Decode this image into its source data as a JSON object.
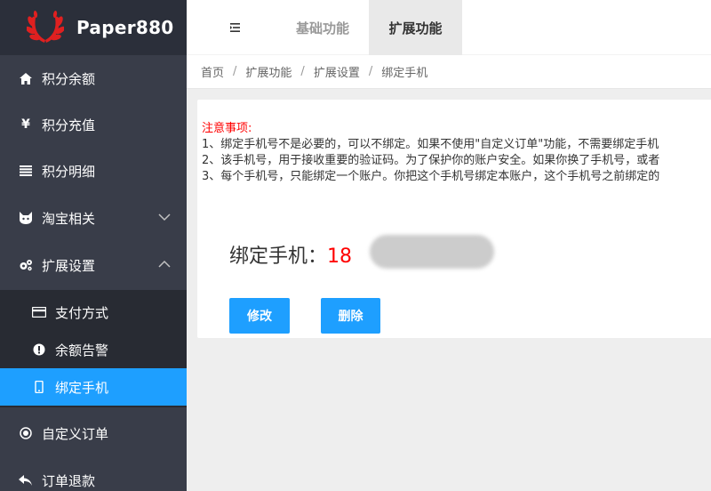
{
  "brand": {
    "name": "Paper880",
    "logo_icon": "laurel-logo-icon",
    "logo_color": "#e02020"
  },
  "sidebar": {
    "items": [
      {
        "label": "积分余额",
        "icon": "home-icon"
      },
      {
        "label": "积分充值",
        "icon": "yen-icon"
      },
      {
        "label": "积分明细",
        "icon": "list-icon"
      },
      {
        "label": "淘宝相关",
        "icon": "cat-icon"
      },
      {
        "label": "扩展设置",
        "icon": "gears-icon"
      },
      {
        "label": "自定义订单",
        "icon": "target-icon"
      },
      {
        "label": "订单退款",
        "icon": "reply-icon"
      }
    ],
    "subitems": [
      {
        "label": "支付方式",
        "icon": "card-icon"
      },
      {
        "label": "余额告警",
        "icon": "alert-icon"
      },
      {
        "label": "绑定手机",
        "icon": "mobile-icon"
      }
    ],
    "active_color": "#1e9fff"
  },
  "header": {
    "tabs": [
      {
        "label": "基础功能"
      },
      {
        "label": "扩展功能"
      }
    ]
  },
  "breadcrumb": [
    "首页",
    "扩展功能",
    "扩展设置",
    "绑定手机"
  ],
  "notice": {
    "title": "注意事项:",
    "lines": [
      "1、绑定手机号不是必要的，可以不绑定。如果不使用\"自定义订单\"功能，不需要绑定手机",
      "2、该手机号，用于接收重要的验证码。为了保护你的账户安全。如果你换了手机号，或者",
      "3、每个手机号，只能绑定一个账户。你把这个手机号绑定本账户，这个手机号之前绑定的"
    ]
  },
  "phone": {
    "label": "绑定手机：",
    "value": "18"
  },
  "buttons": {
    "edit": "修改",
    "delete": "删除"
  }
}
